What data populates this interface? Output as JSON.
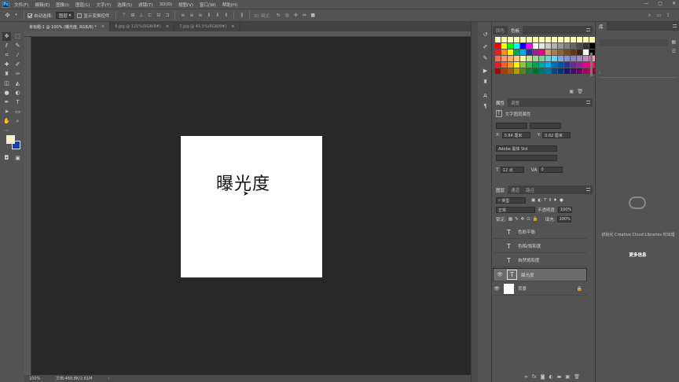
{
  "menubar": {
    "logo": "Ps",
    "items": [
      "文件(F)",
      "编辑(E)",
      "图像(I)",
      "图层(L)",
      "文字(Y)",
      "选择(S)",
      "滤镜(T)",
      "3D(D)",
      "视图(V)",
      "窗口(W)",
      "帮助(H)"
    ],
    "window_controls": [
      "—",
      "▢",
      "✕"
    ]
  },
  "options": {
    "auto_select_label": "自动选择:",
    "auto_select_value": "图层",
    "show_transform_label": "显示变换控件",
    "mode_label": "3D 模式:"
  },
  "tabs": [
    {
      "label": "未标题-1 @ 100% (曝光度, RGB/8) *",
      "close": "×"
    },
    {
      "label": "8.jpg @ 121%(RGB/8#)",
      "close": "×"
    },
    {
      "label": "7.jpg @ 45.5%(RGB/8#)",
      "close": "×"
    }
  ],
  "document": {
    "text": "曝光度"
  },
  "status": {
    "zoom": "100%",
    "doc_info": "文档:468.8K/2.61M",
    "arrow": "›"
  },
  "swatches_panel": {
    "tabs": [
      "颜色",
      "色板"
    ],
    "colors": [
      "#fffbb8",
      "#fffbb8",
      "#fffbb8",
      "#fffbb8",
      "#fffbb8",
      "#fffbb8",
      "#fffbb8",
      "#fffbb8",
      "#fffbb8",
      "#fffbb8",
      "#fffbb8",
      "#fffbb8",
      "#fffbb8",
      "#fffbb8",
      "#fffbb8",
      "#fffbb8",
      "#ff0000",
      "#ffff00",
      "#00ff00",
      "#00ffff",
      "#0000ff",
      "#ff00ff",
      "#ffffff",
      "#e6e6e6",
      "#cccccc",
      "#b3b3b3",
      "#999999",
      "#808080",
      "#666666",
      "#4d4d4d",
      "#333333",
      "#000000",
      "#ed1c24",
      "#f7941d",
      "#fff200",
      "#00a651",
      "#00aeef",
      "#2e3192",
      "#92278f",
      "#ec008c",
      "#c69c6d",
      "#a67c52",
      "#8c6239",
      "#754c24",
      "#603913",
      "#3c2415",
      "#ffffff",
      "#000000",
      "#f26c4f",
      "#f69679",
      "#fbaf5d",
      "#fdc689",
      "#fff799",
      "#c4df9b",
      "#a3d39c",
      "#82ca9c",
      "#7accc8",
      "#6dcff6",
      "#7da7d9",
      "#8393ca",
      "#8781bd",
      "#a187be",
      "#bd8cbf",
      "#f49ac1",
      "#ed1c24",
      "#f26522",
      "#f7941d",
      "#fff200",
      "#8dc63f",
      "#39b54a",
      "#00a651",
      "#00a99d",
      "#00aeef",
      "#0072bc",
      "#0054a6",
      "#2e3192",
      "#662d91",
      "#92278f",
      "#ec008c",
      "#ed145b",
      "#9e0b0f",
      "#a0410d",
      "#a36209",
      "#aba000",
      "#598527",
      "#197b30",
      "#007236",
      "#00746b",
      "#0076a3",
      "#004a80",
      "#003471",
      "#1b1464",
      "#440e62",
      "#630460",
      "#9e005d",
      "#9e0039"
    ]
  },
  "properties_panel": {
    "tabs": [
      "属性",
      "调整"
    ],
    "title": "文字图层属性",
    "x_label": "X:",
    "x_value": "0.84 厘米",
    "y_label": "Y:",
    "y_value": "0.82 厘米",
    "font_family": "Adobe 黑体 Std",
    "font_size": "12 点",
    "tracking": "0"
  },
  "layers_panel": {
    "tabs": [
      "图层",
      "通道",
      "路径"
    ],
    "filter_label": "类型",
    "blend_mode": "正常",
    "opacity_label": "不透明度:",
    "opacity_value": "100%",
    "lock_label": "锁定:",
    "fill_label": "填充:",
    "fill_value": "100%",
    "layers": [
      {
        "name": "色彩平衡",
        "type": "T",
        "visible": false,
        "selected": false
      },
      {
        "name": "色相/饱和度",
        "type": "T",
        "visible": false,
        "selected": false
      },
      {
        "name": "自然饱和度",
        "type": "T",
        "visible": false,
        "selected": false
      },
      {
        "name": "曝光度",
        "type": "T",
        "visible": true,
        "selected": true
      },
      {
        "name": "背景",
        "type": "",
        "visible": true,
        "selected": false
      }
    ],
    "footer_icons": [
      "link-icon",
      "fx-icon",
      "mask-icon",
      "adjustment-icon",
      "group-icon",
      "new-layer-icon",
      "trash-icon"
    ]
  },
  "libraries_panel": {
    "tab": "库",
    "message": "初始化 Creative Cloud Libraries 时出错",
    "link": "更多信息"
  }
}
